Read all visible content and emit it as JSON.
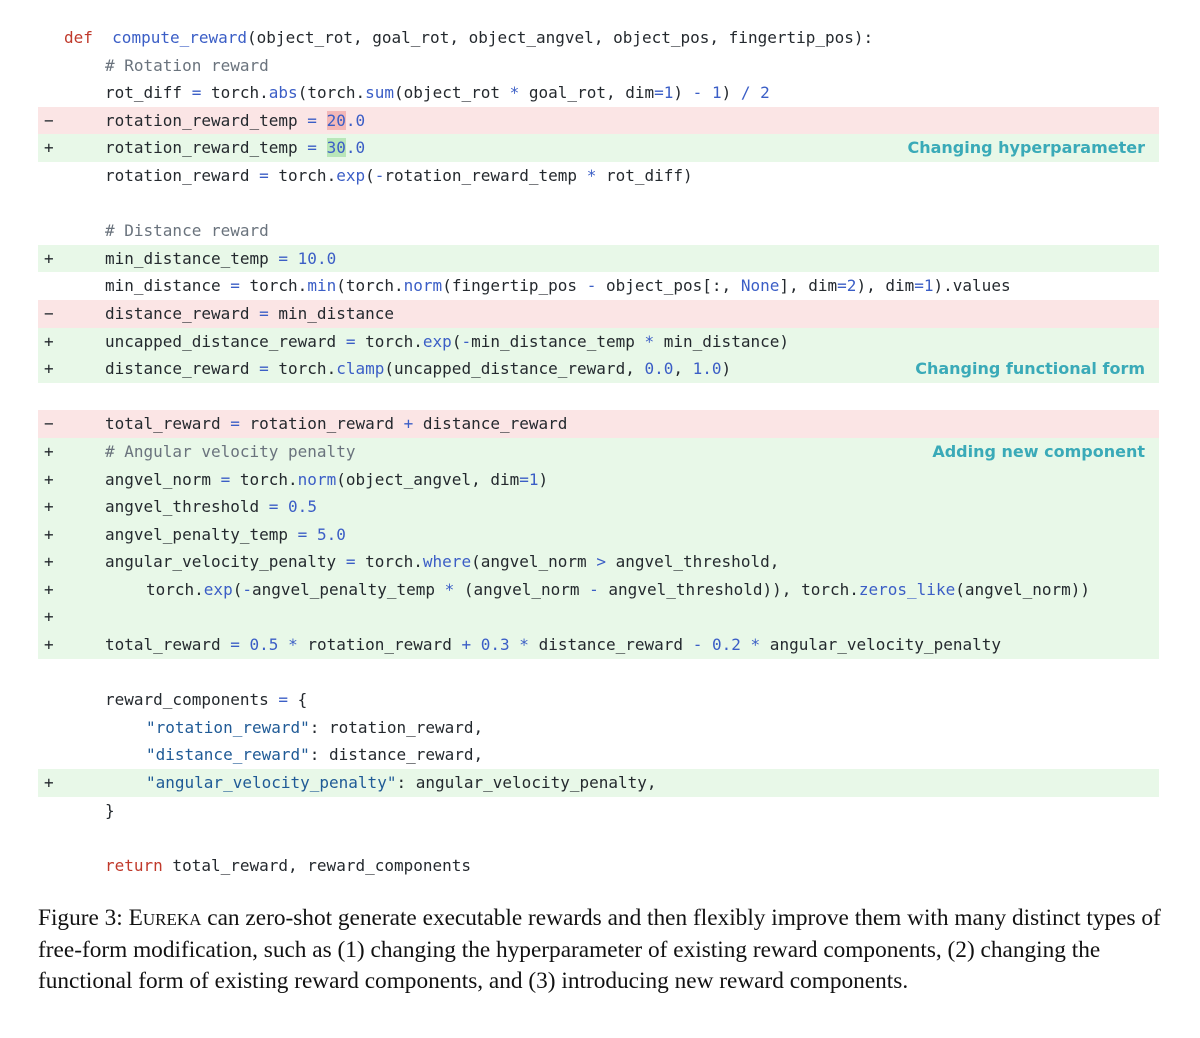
{
  "lines": [
    {
      "type": "ctx",
      "marker": "",
      "indent": 0,
      "tokens": [
        [
          "kw",
          "def"
        ],
        [
          "",
          "  "
        ],
        [
          "fn",
          "compute_reward"
        ],
        [
          "",
          "(object_rot, goal_rot, object_angvel, object_pos, fingertip_pos):"
        ]
      ]
    },
    {
      "type": "ctx",
      "marker": "",
      "indent": 1,
      "tokens": [
        [
          "cm",
          "# Rotation reward"
        ]
      ]
    },
    {
      "type": "ctx",
      "marker": "",
      "indent": 1,
      "tokens": [
        [
          "",
          "rot_diff "
        ],
        [
          "op",
          "="
        ],
        [
          "",
          " torch."
        ],
        [
          "fn",
          "abs"
        ],
        [
          "",
          "(torch."
        ],
        [
          "fn",
          "sum"
        ],
        [
          "",
          "(object_rot "
        ],
        [
          "op",
          "*"
        ],
        [
          "",
          " goal_rot, dim"
        ],
        [
          "op",
          "="
        ],
        [
          "num",
          "1"
        ],
        [
          "",
          ") "
        ],
        [
          "op",
          "-"
        ],
        [
          "",
          " "
        ],
        [
          "num",
          "1"
        ],
        [
          "",
          ") "
        ],
        [
          "op",
          "/"
        ],
        [
          "",
          " "
        ],
        [
          "num",
          "2"
        ]
      ]
    },
    {
      "type": "del",
      "marker": "−",
      "indent": 1,
      "tokens": [
        [
          "",
          "rotation_reward_temp "
        ],
        [
          "op",
          "="
        ],
        [
          "",
          " "
        ],
        [
          "hl-del num",
          "20"
        ],
        [
          "num",
          ".0"
        ]
      ]
    },
    {
      "type": "add",
      "marker": "+",
      "indent": 1,
      "note": "Changing hyperparameter",
      "tokens": [
        [
          "",
          "rotation_reward_temp "
        ],
        [
          "op",
          "="
        ],
        [
          "",
          " "
        ],
        [
          "hl-add num",
          "30"
        ],
        [
          "num",
          ".0"
        ]
      ]
    },
    {
      "type": "ctx",
      "marker": "",
      "indent": 1,
      "tokens": [
        [
          "",
          "rotation_reward "
        ],
        [
          "op",
          "="
        ],
        [
          "",
          " torch."
        ],
        [
          "fn",
          "exp"
        ],
        [
          "",
          "("
        ],
        [
          "op",
          "-"
        ],
        [
          "",
          "rotation_reward_temp "
        ],
        [
          "op",
          "*"
        ],
        [
          "",
          " rot_diff)"
        ]
      ]
    },
    {
      "type": "ctx",
      "marker": "",
      "indent": 0,
      "tokens": []
    },
    {
      "type": "ctx",
      "marker": "",
      "indent": 1,
      "tokens": [
        [
          "cm",
          "# Distance reward"
        ]
      ]
    },
    {
      "type": "add",
      "marker": "+",
      "indent": 1,
      "tokens": [
        [
          "",
          "min_distance_temp "
        ],
        [
          "op",
          "="
        ],
        [
          "",
          " "
        ],
        [
          "num",
          "10.0"
        ]
      ]
    },
    {
      "type": "ctx",
      "marker": "",
      "indent": 1,
      "tokens": [
        [
          "",
          "min_distance "
        ],
        [
          "op",
          "="
        ],
        [
          "",
          " torch."
        ],
        [
          "fn",
          "min"
        ],
        [
          "",
          "(torch."
        ],
        [
          "fn",
          "norm"
        ],
        [
          "",
          "(fingertip_pos "
        ],
        [
          "op",
          "-"
        ],
        [
          "",
          " object_pos[:, "
        ],
        [
          "num",
          "None"
        ],
        [
          "",
          "], dim"
        ],
        [
          "op",
          "="
        ],
        [
          "num",
          "2"
        ],
        [
          "",
          "), dim"
        ],
        [
          "op",
          "="
        ],
        [
          "num",
          "1"
        ],
        [
          "",
          ").values"
        ]
      ]
    },
    {
      "type": "del",
      "marker": "−",
      "indent": 1,
      "tokens": [
        [
          "",
          "distance_reward "
        ],
        [
          "op",
          "="
        ],
        [
          "",
          " min_distance"
        ]
      ]
    },
    {
      "type": "add",
      "marker": "+",
      "indent": 1,
      "tokens": [
        [
          "",
          "uncapped_distance_reward "
        ],
        [
          "op",
          "="
        ],
        [
          "",
          " torch."
        ],
        [
          "fn",
          "exp"
        ],
        [
          "",
          "("
        ],
        [
          "op",
          "-"
        ],
        [
          "",
          "min_distance_temp "
        ],
        [
          "op",
          "*"
        ],
        [
          "",
          " min_distance)"
        ]
      ]
    },
    {
      "type": "add",
      "marker": "+",
      "indent": 1,
      "note": "Changing functional form",
      "tokens": [
        [
          "",
          "distance_reward "
        ],
        [
          "op",
          "="
        ],
        [
          "",
          " torch."
        ],
        [
          "fn",
          "clamp"
        ],
        [
          "",
          "(uncapped_distance_reward, "
        ],
        [
          "num",
          "0.0"
        ],
        [
          "",
          ", "
        ],
        [
          "num",
          "1.0"
        ],
        [
          "",
          ")"
        ]
      ]
    },
    {
      "type": "ctx",
      "marker": "",
      "indent": 0,
      "tokens": []
    },
    {
      "type": "del",
      "marker": "−",
      "indent": 1,
      "tokens": [
        [
          "",
          "total_reward "
        ],
        [
          "op",
          "="
        ],
        [
          "",
          " rotation_reward "
        ],
        [
          "op",
          "+"
        ],
        [
          "",
          " distance_reward"
        ]
      ]
    },
    {
      "type": "add",
      "marker": "+",
      "indent": 1,
      "note": "Adding new component",
      "tokens": [
        [
          "cm",
          "# Angular velocity penalty"
        ]
      ]
    },
    {
      "type": "add",
      "marker": "+",
      "indent": 1,
      "tokens": [
        [
          "",
          "angvel_norm "
        ],
        [
          "op",
          "="
        ],
        [
          "",
          " torch."
        ],
        [
          "fn",
          "norm"
        ],
        [
          "",
          "(object_angvel, dim"
        ],
        [
          "op",
          "="
        ],
        [
          "num",
          "1"
        ],
        [
          "",
          ")"
        ]
      ]
    },
    {
      "type": "add",
      "marker": "+",
      "indent": 1,
      "tokens": [
        [
          "",
          "angvel_threshold "
        ],
        [
          "op",
          "="
        ],
        [
          "",
          " "
        ],
        [
          "num",
          "0.5"
        ]
      ]
    },
    {
      "type": "add",
      "marker": "+",
      "indent": 1,
      "tokens": [
        [
          "",
          "angvel_penalty_temp "
        ],
        [
          "op",
          "="
        ],
        [
          "",
          " "
        ],
        [
          "num",
          "5.0"
        ]
      ]
    },
    {
      "type": "add",
      "marker": "+",
      "indent": 1,
      "tokens": [
        [
          "",
          "angular_velocity_penalty "
        ],
        [
          "op",
          "="
        ],
        [
          "",
          " torch."
        ],
        [
          "fn",
          "where"
        ],
        [
          "",
          "(angvel_norm "
        ],
        [
          "op",
          ">"
        ],
        [
          "",
          " angvel_threshold,"
        ]
      ]
    },
    {
      "type": "add",
      "marker": "+",
      "indent": 2,
      "tokens": [
        [
          "",
          "torch."
        ],
        [
          "fn",
          "exp"
        ],
        [
          "",
          "("
        ],
        [
          "op",
          "-"
        ],
        [
          "",
          "angvel_penalty_temp "
        ],
        [
          "op",
          "*"
        ],
        [
          "",
          " (angvel_norm "
        ],
        [
          "op",
          "-"
        ],
        [
          "",
          " angvel_threshold)), torch."
        ],
        [
          "fn",
          "zeros_like"
        ],
        [
          "",
          "(angvel_norm))"
        ]
      ]
    },
    {
      "type": "add",
      "marker": "+",
      "indent": 0,
      "tokens": []
    },
    {
      "type": "add",
      "marker": "+",
      "indent": 1,
      "tokens": [
        [
          "",
          "total_reward "
        ],
        [
          "op",
          "="
        ],
        [
          "",
          " "
        ],
        [
          "num",
          "0.5"
        ],
        [
          "",
          " "
        ],
        [
          "op",
          "*"
        ],
        [
          "",
          " rotation_reward "
        ],
        [
          "op",
          "+"
        ],
        [
          "",
          " "
        ],
        [
          "num",
          "0.3"
        ],
        [
          "",
          " "
        ],
        [
          "op",
          "*"
        ],
        [
          "",
          " distance_reward "
        ],
        [
          "op",
          "-"
        ],
        [
          "",
          " "
        ],
        [
          "num",
          "0.2"
        ],
        [
          "",
          " "
        ],
        [
          "op",
          "*"
        ],
        [
          "",
          " angular_velocity_penalty"
        ]
      ]
    },
    {
      "type": "ctx",
      "marker": "",
      "indent": 0,
      "tokens": []
    },
    {
      "type": "ctx",
      "marker": "",
      "indent": 1,
      "tokens": [
        [
          "",
          "reward_components "
        ],
        [
          "op",
          "="
        ],
        [
          "",
          " {"
        ]
      ]
    },
    {
      "type": "ctx",
      "marker": "",
      "indent": 2,
      "tokens": [
        [
          "str",
          "\"rotation_reward\""
        ],
        [
          "",
          ": rotation_reward,"
        ]
      ]
    },
    {
      "type": "ctx",
      "marker": "",
      "indent": 2,
      "tokens": [
        [
          "str",
          "\"distance_reward\""
        ],
        [
          "",
          ": distance_reward,"
        ]
      ]
    },
    {
      "type": "add",
      "marker": "+",
      "indent": 2,
      "tokens": [
        [
          "str",
          "\"angular_velocity_penalty\""
        ],
        [
          "",
          ": angular_velocity_penalty,"
        ]
      ]
    },
    {
      "type": "ctx",
      "marker": "",
      "indent": 1,
      "tokens": [
        [
          "",
          "}"
        ]
      ]
    },
    {
      "type": "ctx",
      "marker": "",
      "indent": 0,
      "tokens": []
    },
    {
      "type": "ctx",
      "marker": "",
      "indent": 1,
      "tokens": [
        [
          "kw",
          "return"
        ],
        [
          "",
          " total_reward, reward_components"
        ]
      ]
    }
  ],
  "caption": {
    "label": "Figure 3:",
    "name_first": "E",
    "name_rest": "UREKA",
    "text": " can zero-shot generate executable rewards and then flexibly improve them with many distinct types of free-form modification, such as (1) changing the hyperparameter of existing reward components, (2) changing the functional form of existing reward components, and (3) introducing new reward components."
  }
}
